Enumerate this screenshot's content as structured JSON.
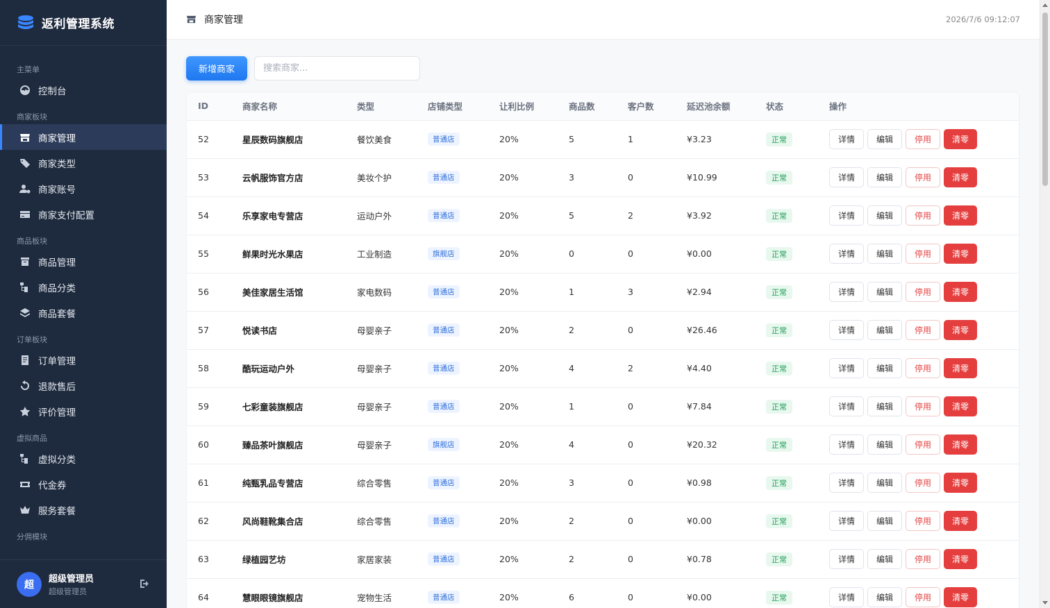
{
  "app": {
    "title": "返利管理系统"
  },
  "nav": {
    "groups": [
      {
        "label": "主菜单"
      },
      {
        "label": "商家板块"
      },
      {
        "label": "商品板块"
      },
      {
        "label": "订单板块"
      },
      {
        "label": "虚拟商品"
      },
      {
        "label": "分佣模块"
      }
    ],
    "items": [
      {
        "label": "控制台",
        "icon": "dashboard-icon"
      },
      {
        "label": "商家管理",
        "icon": "store-icon",
        "active": true
      },
      {
        "label": "商家类型",
        "icon": "tags-icon"
      },
      {
        "label": "商家账号",
        "icon": "user-gear-icon"
      },
      {
        "label": "商家支付配置",
        "icon": "credit-card-icon"
      },
      {
        "label": "商品管理",
        "icon": "box-icon"
      },
      {
        "label": "商品分类",
        "icon": "tree-icon"
      },
      {
        "label": "商品套餐",
        "icon": "layers-icon"
      },
      {
        "label": "订单管理",
        "icon": "receipt-icon"
      },
      {
        "label": "退款售后",
        "icon": "undo-icon"
      },
      {
        "label": "评价管理",
        "icon": "star-icon"
      },
      {
        "label": "虚拟分类",
        "icon": "tree-icon"
      },
      {
        "label": "代金券",
        "icon": "ticket-icon"
      },
      {
        "label": "服务套餐",
        "icon": "crown-icon"
      }
    ]
  },
  "user": {
    "avatar_text": "超",
    "name": "超级管理员",
    "role": "超级管理员"
  },
  "header": {
    "page_title": "商家管理",
    "datetime": "2026/7/6 09:12:07"
  },
  "toolbar": {
    "add_label": "新增商家",
    "search_placeholder": "搜索商家..."
  },
  "table": {
    "columns": [
      "ID",
      "商家名称",
      "类型",
      "店铺类型",
      "让利比例",
      "商品数",
      "客户数",
      "延迟池余额",
      "状态",
      "操作"
    ],
    "actions": {
      "detail": "详情",
      "edit": "编辑",
      "disable": "停用",
      "clear": "清零"
    },
    "rows": [
      {
        "id": "52",
        "name": "星辰数码旗舰店",
        "type": "餐饮美食",
        "shop_type": "普通店",
        "ratio": "20%",
        "products": "5",
        "customers": "1",
        "balance": "¥3.23",
        "status": "正常"
      },
      {
        "id": "53",
        "name": "云帆服饰官方店",
        "type": "美妆个护",
        "shop_type": "普通店",
        "ratio": "20%",
        "products": "3",
        "customers": "0",
        "balance": "¥10.99",
        "status": "正常"
      },
      {
        "id": "54",
        "name": "乐享家电专营店",
        "type": "运动户外",
        "shop_type": "普通店",
        "ratio": "20%",
        "products": "5",
        "customers": "2",
        "balance": "¥3.92",
        "status": "正常"
      },
      {
        "id": "55",
        "name": "鲜果时光水果店",
        "type": "工业制造",
        "shop_type": "旗舰店",
        "ratio": "20%",
        "products": "0",
        "customers": "0",
        "balance": "¥0.00",
        "status": "正常"
      },
      {
        "id": "56",
        "name": "美佳家居生活馆",
        "type": "家电数码",
        "shop_type": "普通店",
        "ratio": "20%",
        "products": "1",
        "customers": "3",
        "balance": "¥2.94",
        "status": "正常"
      },
      {
        "id": "57",
        "name": "悦读书店",
        "type": "母婴亲子",
        "shop_type": "普通店",
        "ratio": "20%",
        "products": "2",
        "customers": "0",
        "balance": "¥26.46",
        "status": "正常"
      },
      {
        "id": "58",
        "name": "酷玩运动户外",
        "type": "母婴亲子",
        "shop_type": "普通店",
        "ratio": "20%",
        "products": "4",
        "customers": "2",
        "balance": "¥4.40",
        "status": "正常"
      },
      {
        "id": "59",
        "name": "七彩童装旗舰店",
        "type": "母婴亲子",
        "shop_type": "普通店",
        "ratio": "20%",
        "products": "1",
        "customers": "0",
        "balance": "¥7.84",
        "status": "正常"
      },
      {
        "id": "60",
        "name": "臻品茶叶旗舰店",
        "type": "母婴亲子",
        "shop_type": "旗舰店",
        "ratio": "20%",
        "products": "4",
        "customers": "0",
        "balance": "¥20.32",
        "status": "正常"
      },
      {
        "id": "61",
        "name": "纯甄乳品专营店",
        "type": "综合零售",
        "shop_type": "普通店",
        "ratio": "20%",
        "products": "3",
        "customers": "0",
        "balance": "¥0.98",
        "status": "正常"
      },
      {
        "id": "62",
        "name": "风尚鞋靴集合店",
        "type": "综合零售",
        "shop_type": "普通店",
        "ratio": "20%",
        "products": "2",
        "customers": "0",
        "balance": "¥0.00",
        "status": "正常"
      },
      {
        "id": "63",
        "name": "绿植园艺坊",
        "type": "家居家装",
        "shop_type": "普通店",
        "ratio": "20%",
        "products": "2",
        "customers": "0",
        "balance": "¥0.78",
        "status": "正常"
      },
      {
        "id": "64",
        "name": "慧眼眼镜旗舰店",
        "type": "宠物生活",
        "shop_type": "普通店",
        "ratio": "20%",
        "products": "6",
        "customers": "0",
        "balance": "¥0.00",
        "status": "正常"
      }
    ]
  },
  "colors": {
    "sidebar_bg": "#1e2a3d",
    "accent": "#1f78f0",
    "danger": "#e53e3e",
    "success": "#1f9d57"
  }
}
